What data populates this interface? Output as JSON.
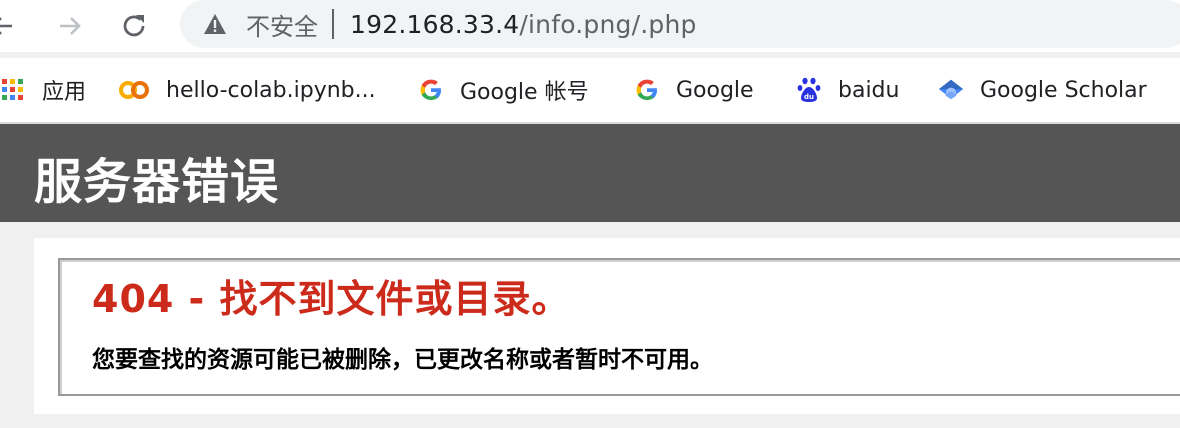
{
  "browser": {
    "address_bar": {
      "security_label": "不安全",
      "url_host": "192.168.33.4",
      "url_path": "/info.png/.php"
    },
    "bookmarks": [
      {
        "label": "应用",
        "icon": "apps-grid-icon"
      },
      {
        "label": "hello-colab.ipynb...",
        "icon": "colab-icon"
      },
      {
        "label": "Google 帐号",
        "icon": "google-g-icon"
      },
      {
        "label": "Google",
        "icon": "google-g-icon"
      },
      {
        "label": "baidu",
        "icon": "baidu-paw-icon"
      },
      {
        "label": "Google Scholar",
        "icon": "google-scholar-icon"
      }
    ]
  },
  "page": {
    "header_title": "服务器错误",
    "error_title": "404 - 找不到文件或目录。",
    "error_message": "您要查找的资源可能已被删除，已更改名称或者暂时不可用。"
  },
  "colors": {
    "header_bg": "#555555",
    "error_red": "#cc2a1a",
    "page_bg": "#f0f0f0"
  }
}
